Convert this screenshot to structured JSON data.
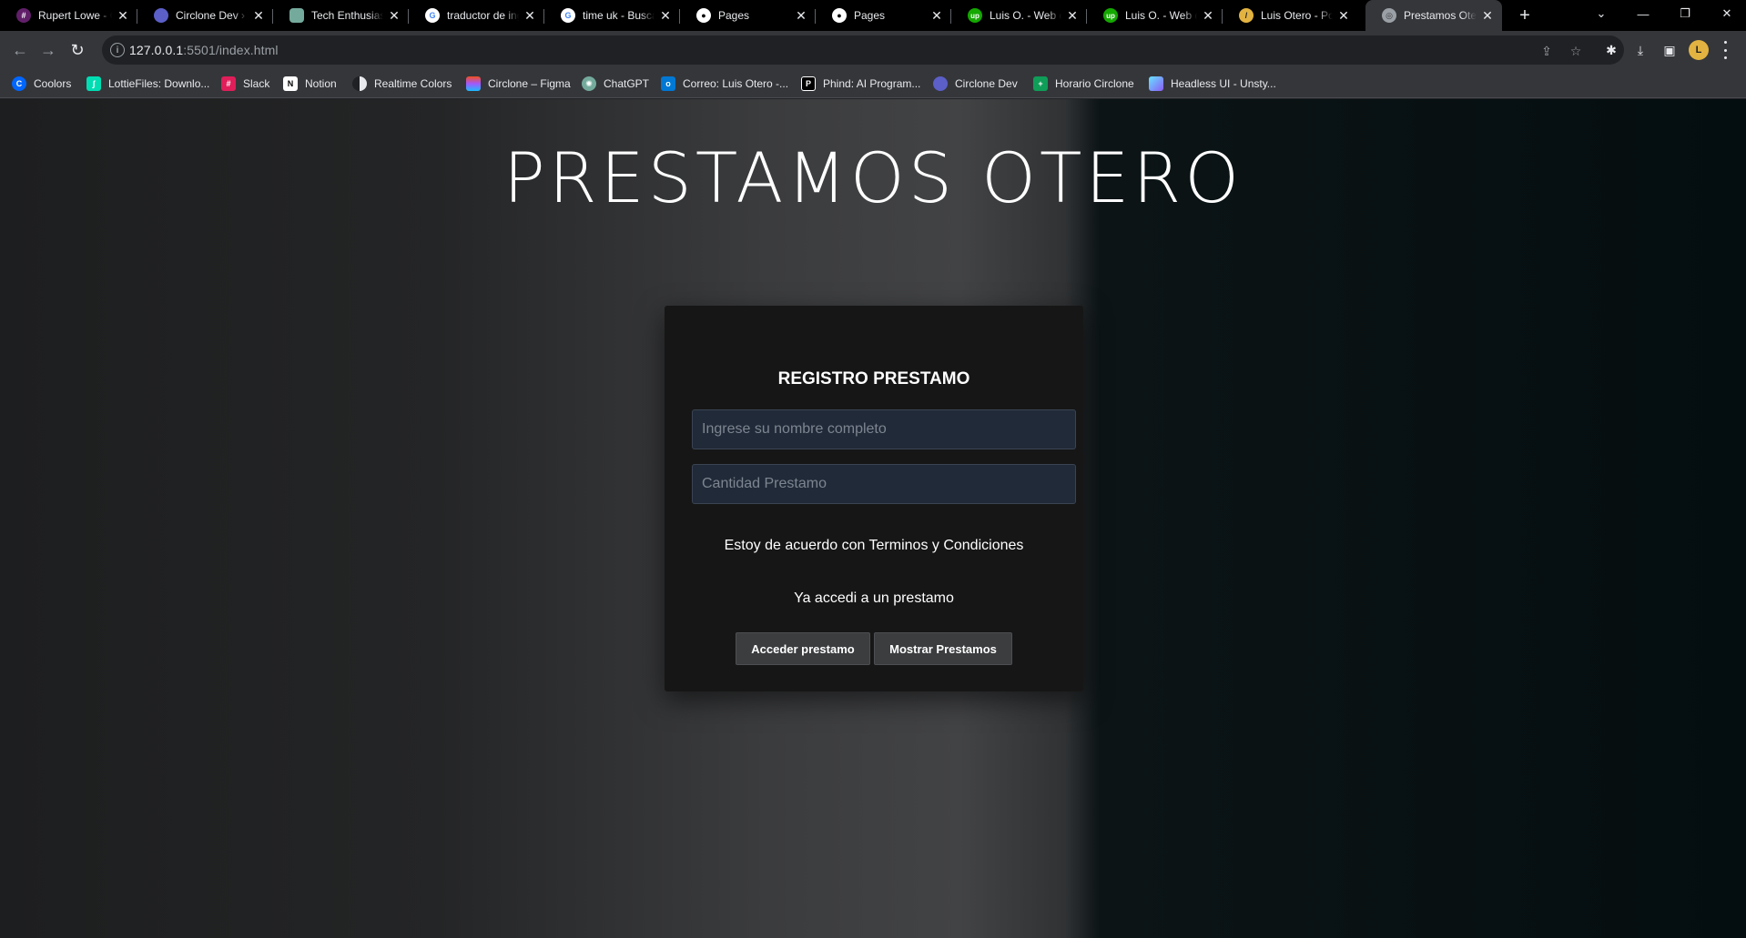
{
  "browser": {
    "tabs": [
      {
        "title": "Rupert Lowe - Circlone",
        "favicon": "slack-icon",
        "color": "#4a154b"
      },
      {
        "title": "Circlone Dev › Agenda",
        "favicon": "circlone-icon",
        "color": "#5b5fc7"
      },
      {
        "title": "Tech Enthusiast",
        "favicon": "chatgpt-icon",
        "color": "#74aa9c"
      },
      {
        "title": "traductor de ingles",
        "favicon": "google-icon",
        "color": "#ffffff"
      },
      {
        "title": "time uk - Buscar",
        "favicon": "google-icon",
        "color": "#ffffff"
      },
      {
        "title": "Pages",
        "favicon": "github-icon",
        "color": "#ffffff"
      },
      {
        "title": "Pages",
        "favicon": "github-icon",
        "color": "#ffffff"
      },
      {
        "title": "Luis O. - Web developer",
        "favicon": "upwork-icon",
        "color": "#14a800"
      },
      {
        "title": "Luis O. - Web developer",
        "favicon": "upwork-icon",
        "color": "#14a800"
      },
      {
        "title": "Luis Otero - Portfolio",
        "favicon": "portfolio-icon",
        "color": "#e3b341"
      },
      {
        "title": "Prestamos Otero",
        "favicon": "globe-icon",
        "color": "#9aa0a6"
      }
    ],
    "url_host": "127.0.0.1",
    "url_rest": ":5501/index.html",
    "bookmarks": [
      {
        "label": "Coolors",
        "icon": "coolors-icon",
        "color": "#0066ff"
      },
      {
        "label": "LottieFiles: Downlo...",
        "icon": "lottiefiles-icon",
        "color": "#00ddb3"
      },
      {
        "label": "Slack",
        "icon": "slack-icon",
        "color": "#e01e5a"
      },
      {
        "label": "Notion",
        "icon": "notion-icon",
        "color": "#ffffff"
      },
      {
        "label": "Realtime Colors",
        "icon": "realtime-colors-icon",
        "color": "#ffffff"
      },
      {
        "label": "Circlone – Figma",
        "icon": "figma-icon",
        "color": "#f24e1e"
      },
      {
        "label": "ChatGPT",
        "icon": "chatgpt-icon",
        "color": "#74aa9c"
      },
      {
        "label": "Correo: Luis Otero -...",
        "icon": "outlook-icon",
        "color": "#0078d4"
      },
      {
        "label": "Phind: AI Program...",
        "icon": "phind-icon",
        "color": "#000000"
      },
      {
        "label": "Circlone Dev",
        "icon": "circlone-icon",
        "color": "#5b5fc7"
      },
      {
        "label": "Horario Circlone",
        "icon": "sheets-icon",
        "color": "#0f9d58"
      },
      {
        "label": "Headless UI - Unsty...",
        "icon": "headlessui-icon",
        "color": "#66e3ff"
      }
    ]
  },
  "page": {
    "title": "PRESTAMOS OTERO",
    "form": {
      "heading": "REGISTRO PRESTAMO",
      "name_placeholder": "Ingrese su nombre completo",
      "amount_placeholder": "Cantidad Prestamo",
      "terms_text": "Estoy de acuerdo con Terminos y Condiciones",
      "already_text": "Ya accedi a un prestamo",
      "submit_label": "Acceder prestamo",
      "show_label": "Mostrar Prestamos"
    }
  }
}
